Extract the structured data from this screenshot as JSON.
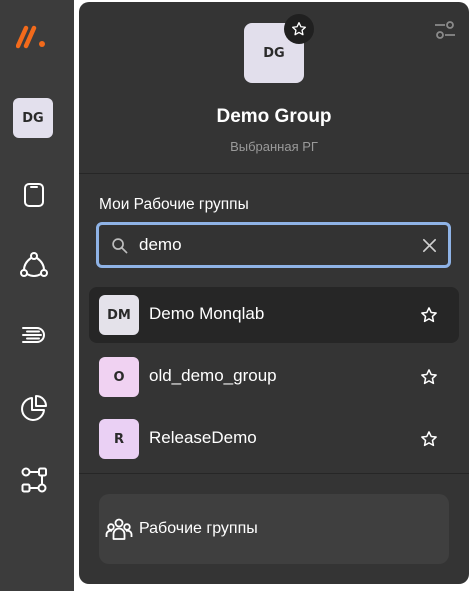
{
  "colors": {
    "rail_bg": "#3c3c3c",
    "panel_bg": "#343434",
    "active_row_bg": "#262626",
    "search_border": "#8fb3e6",
    "logo_accent": "#f26a1b",
    "subtitle": "#9a9a9a"
  },
  "rail": {
    "logo_icon": "brand-logo",
    "user_initials": "DG",
    "icons": [
      "tablet-icon",
      "network-icon",
      "stream-icon",
      "pie-chart-icon",
      "workflow-icon"
    ]
  },
  "header": {
    "settings_icon": "sliders-icon",
    "initials": "DG",
    "star_icon": "star-icon",
    "title": "Demo Group",
    "subtitle": "Выбранная РГ"
  },
  "section": {
    "title": "Мои Рабочие группы"
  },
  "search": {
    "value": "demo",
    "placeholder": ""
  },
  "groups": [
    {
      "initials": "DM",
      "name": "Demo Monqlab",
      "avatar_color": "#e4e2ea",
      "active": true
    },
    {
      "initials": "O",
      "name": "old_demo_group",
      "avatar_color": "#f0d2f2",
      "active": false
    },
    {
      "initials": "R",
      "name": "ReleaseDemo",
      "avatar_color": "#ead0f4",
      "active": false
    }
  ],
  "footer": {
    "label": "Рабочие группы",
    "icon": "users-group-icon"
  }
}
